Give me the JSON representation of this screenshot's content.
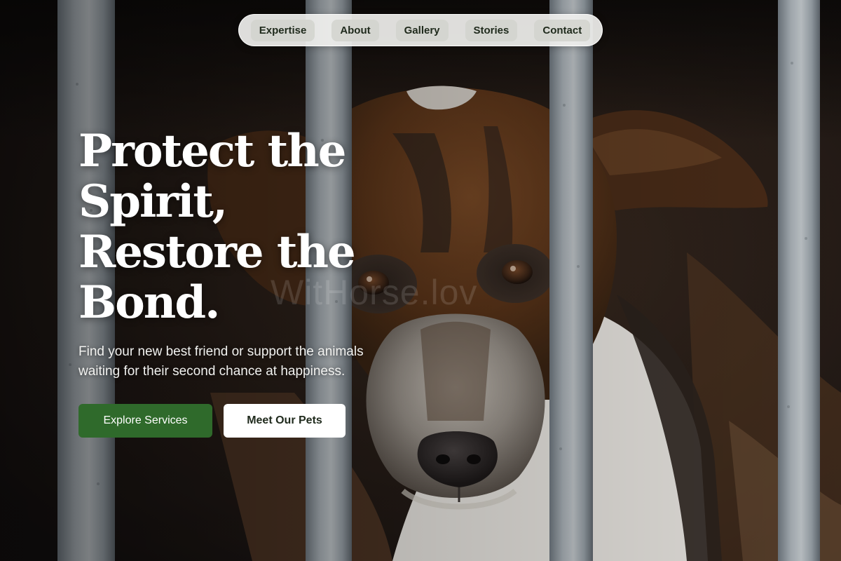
{
  "nav": {
    "items": [
      {
        "label": "Expertise"
      },
      {
        "label": "About"
      },
      {
        "label": "Gallery"
      },
      {
        "label": "Stories"
      },
      {
        "label": "Contact"
      }
    ]
  },
  "hero": {
    "headline_lines": [
      "Protect the",
      "Spirit,",
      "Restore the",
      "Bond."
    ],
    "subtitle_lines": [
      "Find your new best friend or support the animals",
      "waiting for their second chance at happiness."
    ],
    "primary_cta": "Explore Services",
    "secondary_cta": "Meet Our Pets",
    "watermark": "WitHorse.lov",
    "background_image": "dog-behind-cage-bars-photo"
  },
  "colors": {
    "primary_button": "#2f6a2b",
    "secondary_button": "#ffffff",
    "nav_background": "#f0f0ee"
  }
}
